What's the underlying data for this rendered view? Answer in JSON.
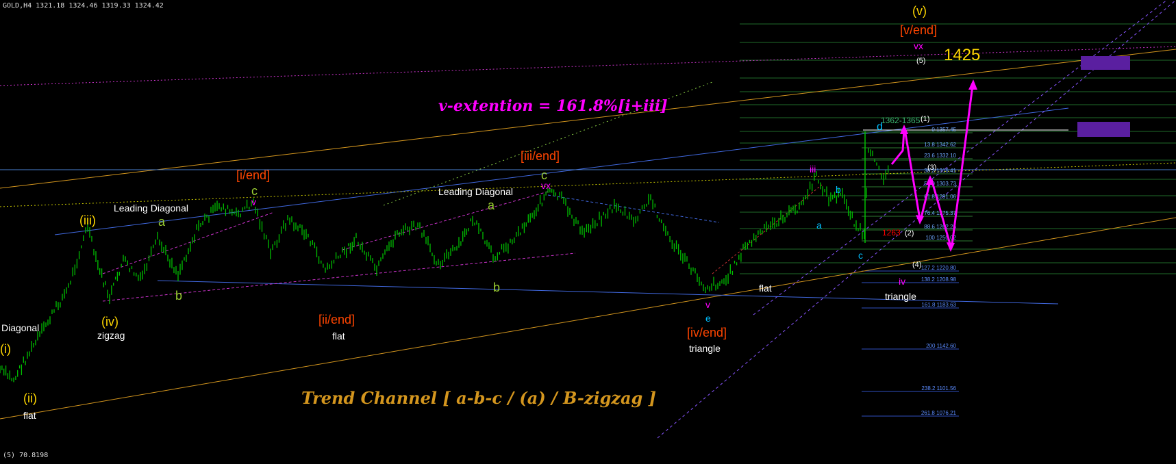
{
  "header": {
    "symbol_label": "GOLD,H4  1321.18 1324.46 1319.33 1324.42",
    "indicator_label": "(5) 70.8198"
  },
  "annotations": {
    "extension_note": "v-extention = 161.8%[i+iii]",
    "channel_note": "Trend Channel  [ a-b-c / (a) / B-zigzag ]",
    "target_label": "1425",
    "range_label": "1362-1365",
    "top_wave": "(v)",
    "top_end": "[v/end]",
    "top_vx": "vx",
    "top_5": "(5)"
  },
  "wave_labels": [
    {
      "text": "[i/end]",
      "color": "#ff4500"
    },
    {
      "text": "c",
      "color": "#9acd32"
    },
    {
      "text": "v",
      "color": "#ff00ff"
    },
    {
      "text": "[iii/end]",
      "color": "#ff4500"
    },
    {
      "text": "c",
      "color": "#9acd32"
    },
    {
      "text": "vx",
      "color": "#ff00ff"
    },
    {
      "text": "[ii/end]",
      "color": "#ff4500"
    },
    {
      "text": "flat",
      "color": "#ffffff"
    },
    {
      "text": "[iv/end]",
      "color": "#ff4500"
    },
    {
      "text": "triangle",
      "color": "#ffffff"
    },
    {
      "text": "(iii)",
      "color": "#ffd700"
    },
    {
      "text": "(iv)",
      "color": "#ffd700"
    },
    {
      "text": "zigzag",
      "color": "#ffffff"
    },
    {
      "text": "(ii)",
      "color": "#ffd700"
    },
    {
      "text": "flat",
      "color": "#ffffff"
    },
    {
      "text": "(i)",
      "color": "#ffd700"
    },
    {
      "text": "Diagonal",
      "color": "#ffffff"
    },
    {
      "text": "Leading Diagonal",
      "color": "#ffffff"
    },
    {
      "text": "a",
      "color": "#9acd32"
    },
    {
      "text": "b",
      "color": "#9acd32"
    },
    {
      "text": "Leading Diagonal",
      "color": "#ffffff"
    },
    {
      "text": "a",
      "color": "#9acd32"
    },
    {
      "text": "b",
      "color": "#9acd32"
    },
    {
      "text": "e",
      "color": "#00bfff"
    },
    {
      "text": "v",
      "color": "#ff00ff"
    },
    {
      "text": "flat",
      "color": "#ffffff"
    },
    {
      "text": "iii",
      "color": "#ff00ff"
    },
    {
      "text": "d",
      "color": "#00bfff"
    },
    {
      "text": "(1)",
      "color": "#ffffff"
    },
    {
      "text": "(3)",
      "color": "#ffffff"
    },
    {
      "text": "1263",
      "color": "#ff0000"
    },
    {
      "text": "(2)",
      "color": "#ffffff"
    },
    {
      "text": "(4)",
      "color": "#ffffff"
    },
    {
      "text": "triangle",
      "color": "#ffffff"
    },
    {
      "text": "iv",
      "color": "#ff00ff"
    },
    {
      "text": "c",
      "color": "#00bfff"
    },
    {
      "text": "b",
      "color": "#00bfff"
    },
    {
      "text": "a",
      "color": "#00bfff"
    }
  ],
  "fib_levels": [
    {
      "label": "0 1357.45"
    },
    {
      "label": "13.8 1342.62"
    },
    {
      "label": "23.6 1332.10"
    },
    {
      "label": "38.2 1316.41"
    },
    {
      "label": "50.0 1303.73"
    },
    {
      "label": "61.8 1291.06"
    },
    {
      "label": "76.4 1275.37"
    },
    {
      "label": "88.6 1262.26"
    },
    {
      "label": "100 1250.02"
    },
    {
      "label": "127.2 1220.80"
    },
    {
      "label": "138.2 1208.98"
    },
    {
      "label": "161.8 1183.63"
    },
    {
      "label": "200 1142.60"
    },
    {
      "label": "238.2 1101.56"
    },
    {
      "label": "261.8 1076.21"
    }
  ],
  "colors": {
    "background": "#000000",
    "candles": "#00c000",
    "orange_channel": "#d4961e",
    "blue_line": "#4169e1",
    "magenta": "#ff00ff",
    "fib_green": "#2e7d32",
    "purple_box": "#5a1fa0"
  },
  "chart_data": {
    "type": "candlestick",
    "series_name": "GOLD,H4",
    "last_bar": {
      "open": 1321.18,
      "high": 1324.46,
      "low": 1319.33,
      "close": 1324.42
    },
    "wave_pivots": [
      {
        "label": "(i)",
        "price": 1180
      },
      {
        "label": "(ii)",
        "price": 1133
      },
      {
        "label": "(iii)",
        "price": 1258
      },
      {
        "label": "(iv)",
        "price": 1205
      },
      {
        "label": "[i/end]",
        "price": 1268
      },
      {
        "label": "[ii/end]",
        "price": 1203
      },
      {
        "label": "[iii/end]",
        "price": 1297
      },
      {
        "label": "[iv/end]",
        "price": 1196
      },
      {
        "label": "(1)",
        "price": 1365
      },
      {
        "label": "(2)",
        "price": 1263
      },
      {
        "label": "(3)",
        "price": 1316
      },
      {
        "label": "(4)",
        "price": 1232
      },
      {
        "label": "(v)",
        "price": 1425
      }
    ],
    "target": 1425,
    "resistance_range": [
      1362,
      1365
    ]
  }
}
